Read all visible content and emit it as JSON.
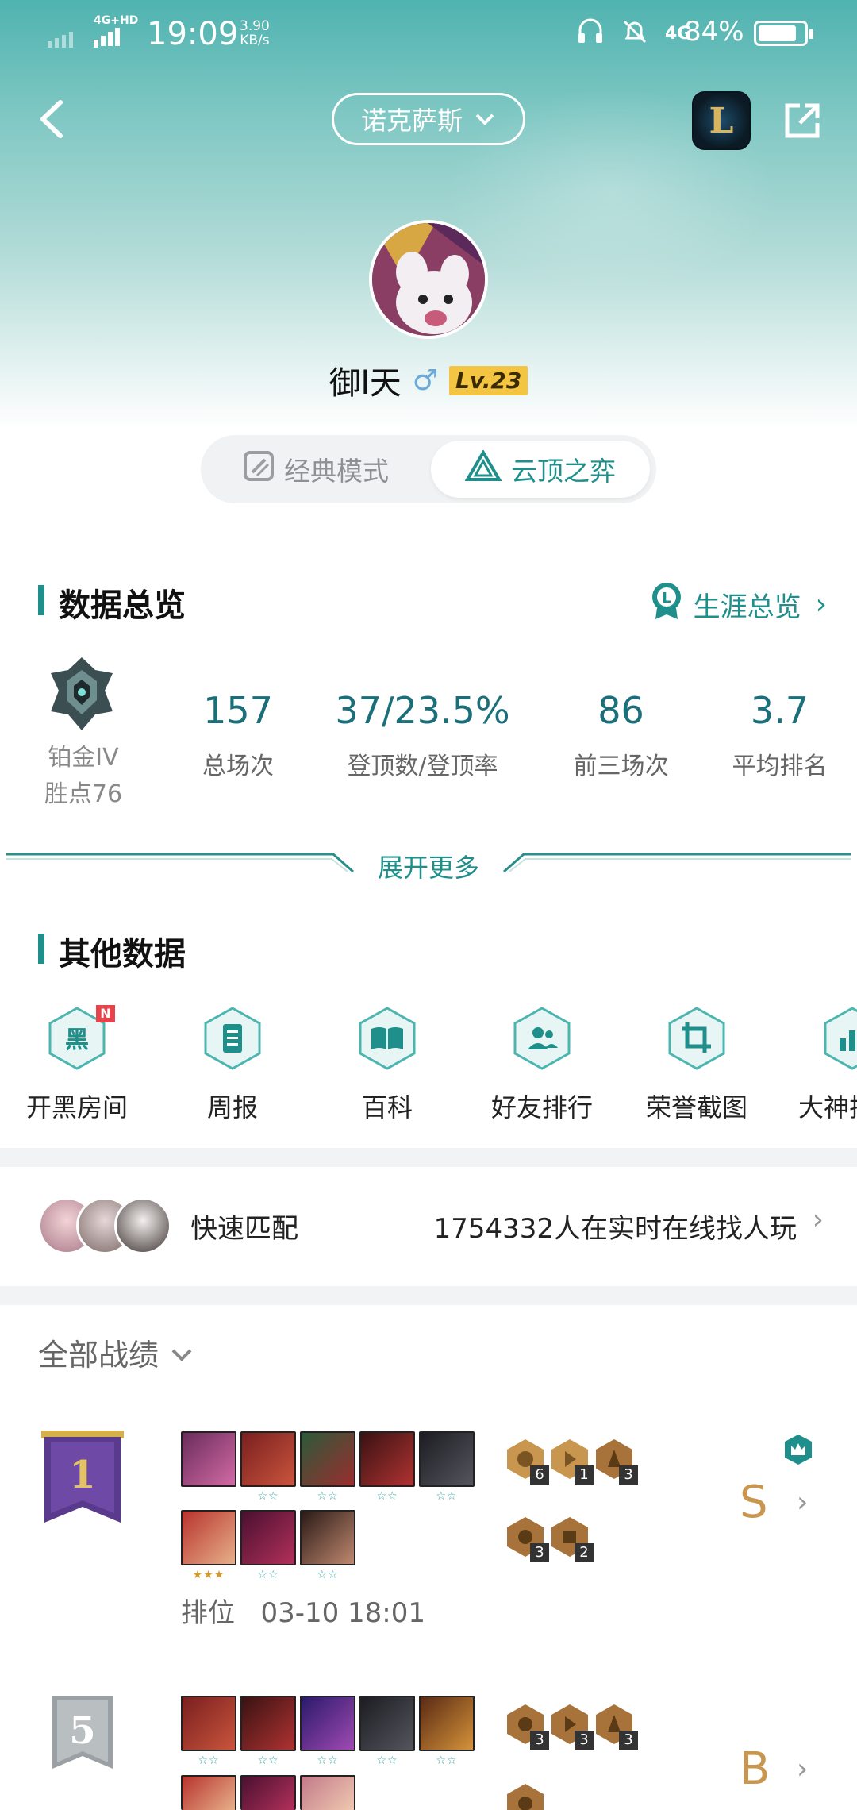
{
  "status_bar": {
    "network": "4G+HD",
    "time": "19:09",
    "speed_value": "3.90",
    "speed_unit": "KB/s",
    "network_right": "4G",
    "battery": "84%",
    "battery_level": 0.84
  },
  "header": {
    "server": "诺克萨斯",
    "username": "御l天",
    "gender_symbol": "♂",
    "level": "Lv.23"
  },
  "mode_toggle": {
    "classic": "经典模式",
    "tft": "云顶之弈",
    "selected": "云顶之弈"
  },
  "overview": {
    "title": "数据总览",
    "career_link": "生涯总览",
    "rank": "铂金IV",
    "points": "胜点76",
    "stats": [
      {
        "value": "157",
        "label": "总场次"
      },
      {
        "value": "37/23.5%",
        "label": "登顶数/登顶率"
      },
      {
        "value": "86",
        "label": "前三场次"
      },
      {
        "value": "3.7",
        "label": "平均排名"
      }
    ],
    "expand": "展开更多"
  },
  "other": {
    "title": "其他数据",
    "tools": [
      {
        "label": "开黑房间",
        "icon": "黑",
        "badge": "N"
      },
      {
        "label": "周报",
        "icon": "report-icon"
      },
      {
        "label": "百科",
        "icon": "book-icon"
      },
      {
        "label": "好友排行",
        "icon": "friends-icon"
      },
      {
        "label": "荣誉截图",
        "icon": "crop-icon"
      },
      {
        "label": "大神排",
        "icon": "chart-icon"
      }
    ]
  },
  "quick_match": {
    "title": "快速匹配",
    "online": "1754332人在实时在线找人玩"
  },
  "records": {
    "filter": "全部战绩",
    "matches": [
      {
        "placement": "1",
        "grade": "S",
        "queue": "排位",
        "datetime": "03-10 18:01",
        "traits": [
          "6",
          "1",
          "3",
          "3",
          "2"
        ]
      },
      {
        "placement": "5",
        "grade": "B",
        "traits": [
          "3",
          "3",
          "3"
        ]
      }
    ]
  }
}
